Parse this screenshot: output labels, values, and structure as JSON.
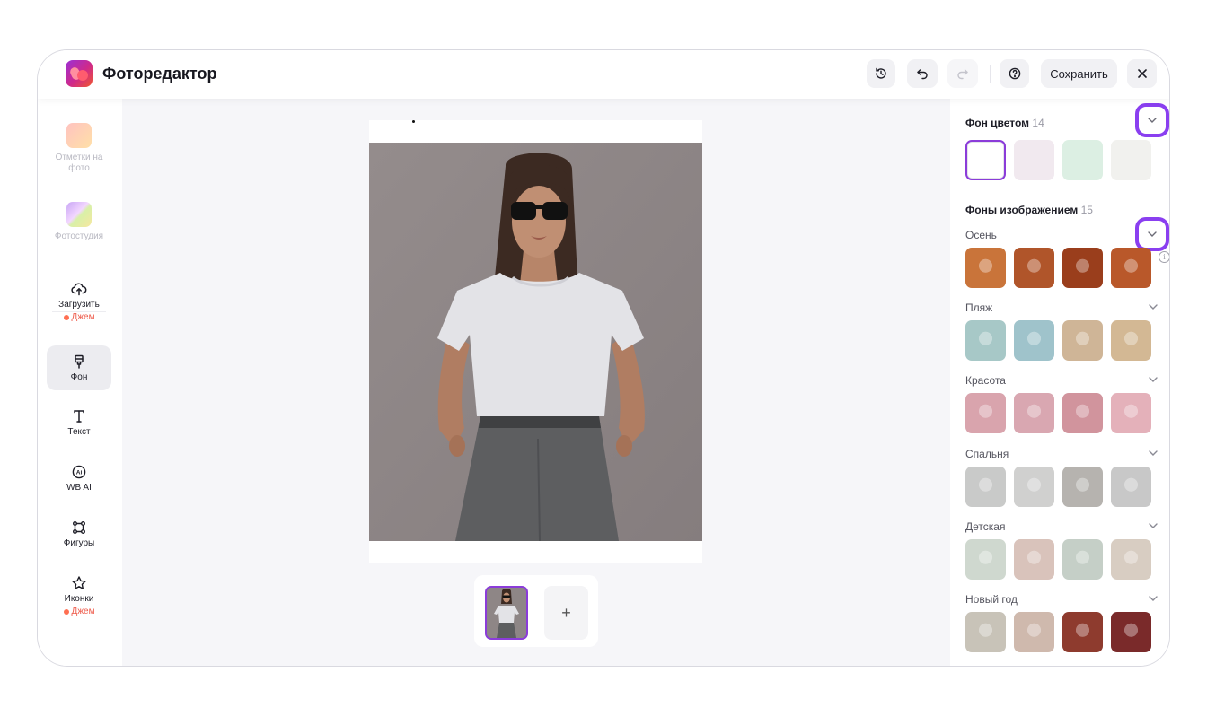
{
  "app": {
    "title": "Фоторедактор"
  },
  "header": {
    "history_icon": "history-icon",
    "undo_icon": "undo-icon",
    "redo_icon": "redo-icon",
    "help_icon": "help-icon",
    "save_label": "Сохранить",
    "close_icon": "close-icon"
  },
  "sidebar": {
    "items": [
      {
        "label": "Отметки на фото",
        "icon": "photo-tags-icon",
        "state": "disabled"
      },
      {
        "label": "Фотостудия",
        "icon": "photo-studio-icon",
        "state": "disabled"
      },
      {
        "label": "Загрузить",
        "icon": "upload-icon",
        "promo": "Джем"
      },
      {
        "label": "Фон",
        "icon": "background-icon",
        "state": "active"
      },
      {
        "label": "Текст",
        "icon": "text-icon"
      },
      {
        "label": "WB AI",
        "icon": "ai-icon"
      },
      {
        "label": "Фигуры",
        "icon": "shapes-icon"
      },
      {
        "label": "Иконки",
        "icon": "star-icon",
        "promo": "Джем"
      }
    ]
  },
  "canvas": {
    "add_slide": "+"
  },
  "panel": {
    "color_bg": {
      "title": "Фон цветом",
      "count": "14",
      "swatches": [
        "#ffffff",
        "#f1e9ef",
        "#dcefe3",
        "#f1f1ee"
      ]
    },
    "image_bg": {
      "title": "Фоны изображением",
      "count": "15",
      "info_icon": "info-icon"
    },
    "categories": [
      {
        "name": "Осень",
        "tiles": [
          "#c9743a",
          "#b0552a",
          "#9a3e1c",
          "#b9582a"
        ]
      },
      {
        "name": "Пляж",
        "tiles": [
          "#a7c8c7",
          "#9fc3cb",
          "#cfb597",
          "#d3b894"
        ]
      },
      {
        "name": "Красота",
        "tiles": [
          "#d9a4ad",
          "#d9a7b1",
          "#d1949d",
          "#e4b1ba"
        ]
      },
      {
        "name": "Спальня",
        "tiles": [
          "#c9cac9",
          "#d0d0cf",
          "#b6b3af",
          "#c8c8c8"
        ]
      },
      {
        "name": "Детская",
        "tiles": [
          "#cfd8cf",
          "#d9c3bb",
          "#c5cfc7",
          "#d8cdc2"
        ]
      },
      {
        "name": "Новый год",
        "tiles": [
          "#c8c3b8",
          "#cfb9ad",
          "#8e3b2e",
          "#7a2a2a"
        ]
      }
    ]
  }
}
